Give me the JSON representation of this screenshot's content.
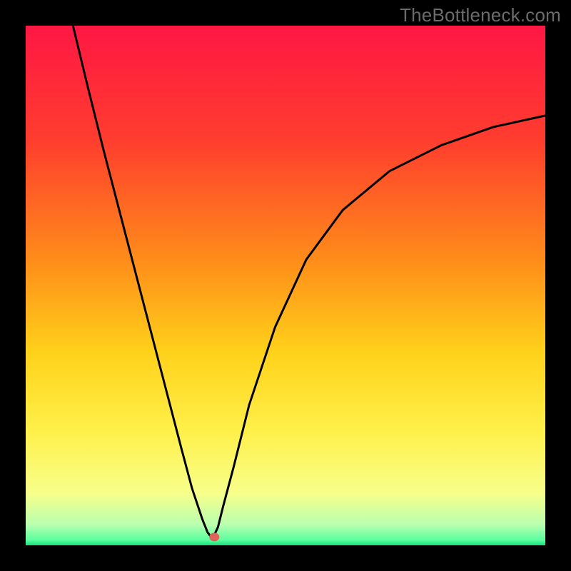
{
  "watermark": "TheBottleneck.com",
  "chart_data": {
    "type": "line",
    "title": "",
    "xlabel": "",
    "ylabel": "",
    "xlim": [
      0,
      100
    ],
    "ylim": [
      0,
      100
    ],
    "gradient_stops": [
      {
        "offset": 0,
        "color": "#ff1744"
      },
      {
        "offset": 22,
        "color": "#ff3d2e"
      },
      {
        "offset": 45,
        "color": "#ff8c1a"
      },
      {
        "offset": 63,
        "color": "#ffd21a"
      },
      {
        "offset": 78,
        "color": "#fff04a"
      },
      {
        "offset": 90,
        "color": "#f7ff8a"
      },
      {
        "offset": 96,
        "color": "#baffb0"
      },
      {
        "offset": 99,
        "color": "#5aff9e"
      },
      {
        "offset": 100,
        "color": "#16e07d"
      }
    ],
    "series": [
      {
        "name": "bottleneck-curve",
        "x": [
          9.1,
          12,
          15,
          18,
          21,
          24,
          27,
          30,
          32,
          34,
          35,
          35.6,
          36.3,
          37,
          38,
          40,
          43,
          48,
          54,
          61,
          70,
          80,
          90,
          100
        ],
        "y": [
          100,
          88,
          76,
          64.5,
          53,
          41.5,
          30,
          18.5,
          11,
          5,
          2.5,
          1.7,
          2,
          3.5,
          7.5,
          15,
          27,
          42,
          55,
          64.5,
          72,
          77,
          80.5,
          82.7
        ]
      }
    ],
    "marker": {
      "x": 36.3,
      "y": 1.6,
      "color": "#e0635a"
    }
  }
}
